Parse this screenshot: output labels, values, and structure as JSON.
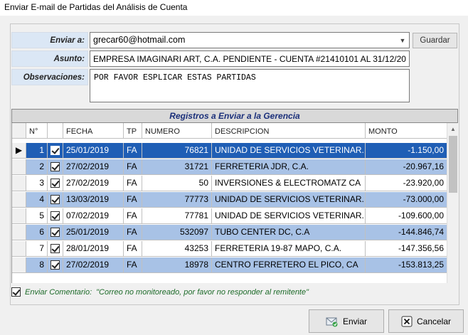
{
  "window": {
    "title": "Enviar E-mail de Partidas del Análisis de Cuenta"
  },
  "form": {
    "enviar_label": "Enviar a:",
    "enviar_value": "grecar60@hotmail.com",
    "guardar_label": "Guardar",
    "asunto_label": "Asunto:",
    "asunto_value": "EMPRESA IMAGINARI ART, C.A. PENDIENTE - CUENTA #21410101 AL 31/12/20",
    "observaciones_label": "Observaciones:",
    "observaciones_value": "POR FAVOR ESPLICAR ESTAS PARTIDAS"
  },
  "grid": {
    "title": "Registros a Enviar a la Gerencia",
    "columns": [
      "N°",
      "",
      "FECHA",
      "TP",
      "NUMERO",
      "DESCRIPCION",
      "MONTO"
    ],
    "rows": [
      {
        "n": "1",
        "fecha": "25/01/2019",
        "tp": "FA",
        "numero": "76821",
        "descripcion": "UNIDAD DE SERVICIOS VETERINAR...",
        "monto": "-1.150,00"
      },
      {
        "n": "2",
        "fecha": "27/02/2019",
        "tp": "FA",
        "numero": "31721",
        "descripcion": "FERRETERIA JDR, C.A.",
        "monto": "-20.967,16"
      },
      {
        "n": "3",
        "fecha": "27/02/2019",
        "tp": "FA",
        "numero": "50",
        "descripcion": "INVERSIONES & ELECTROMATZ CA",
        "monto": "-23.920,00"
      },
      {
        "n": "4",
        "fecha": "13/03/2019",
        "tp": "FA",
        "numero": "77773",
        "descripcion": "UNIDAD DE SERVICIOS VETERINAR...",
        "monto": "-73.000,00"
      },
      {
        "n": "5",
        "fecha": "07/02/2019",
        "tp": "FA",
        "numero": "77781",
        "descripcion": "UNIDAD DE SERVICIOS VETERINAR...",
        "monto": "-109.600,00"
      },
      {
        "n": "6",
        "fecha": "25/01/2019",
        "tp": "FA",
        "numero": "532097",
        "descripcion": "TUBO CENTER DC, C.A",
        "monto": "-144.846,74"
      },
      {
        "n": "7",
        "fecha": "28/01/2019",
        "tp": "FA",
        "numero": "43253",
        "descripcion": "FERRETERIA 19-87 MAPO, C.A.",
        "monto": "-147.356,56"
      },
      {
        "n": "8",
        "fecha": "27/02/2019",
        "tp": "FA",
        "numero": "18978",
        "descripcion": "CENTRO FERRETERO EL PICO, CA",
        "monto": "-153.813,25"
      }
    ]
  },
  "comment": {
    "label": "Enviar Comentario:",
    "text": "\"Correo no monitoreado, por favor no responder al remitente\""
  },
  "buttons": {
    "enviar": "Enviar",
    "cancelar": "Cancelar"
  },
  "colors": {
    "selected_row": "#1f5eb5",
    "alt_row": "#a8c2e6",
    "label_bg": "#dbe7f5"
  }
}
